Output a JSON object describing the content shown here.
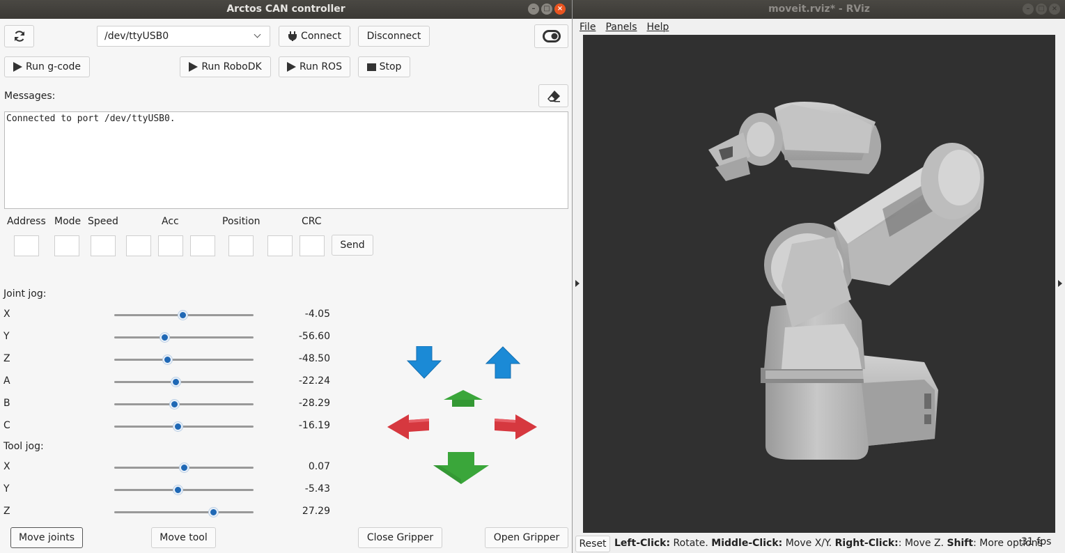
{
  "left_window": {
    "title": "Arctos CAN controller",
    "port_select": {
      "value": "/dev/ttyUSB0"
    },
    "buttons": {
      "connect": "Connect",
      "disconnect": "Disconnect",
      "run_gcode": "Run g-code",
      "run_robodk": "Run RoboDK",
      "run_ros": "Run ROS",
      "stop": "Stop",
      "send": "Send",
      "move_joints": "Move joints",
      "move_tool": "Move tool",
      "close_gripper": "Close Gripper",
      "open_gripper": "Open Gripper"
    },
    "messages_label": "Messages:",
    "messages_text": "Connected to port /dev/ttyUSB0.",
    "can_fields": {
      "headers": [
        "Address",
        "Mode",
        "Speed",
        "Acc",
        "Position",
        "CRC"
      ]
    },
    "joint_jog": {
      "label": "Joint jog:",
      "axes": [
        {
          "name": "X",
          "value": "-4.05",
          "level": 0.49
        },
        {
          "name": "Y",
          "value": "-56.60",
          "level": 0.36
        },
        {
          "name": "Z",
          "value": "-48.50",
          "level": 0.38
        },
        {
          "name": "A",
          "value": "-22.24",
          "level": 0.44
        },
        {
          "name": "B",
          "value": "-28.29",
          "level": 0.43
        },
        {
          "name": "C",
          "value": "-16.19",
          "level": 0.455
        }
      ]
    },
    "tool_jog": {
      "label": "Tool jog:",
      "axes": [
        {
          "name": "X",
          "value": "0.07",
          "level": 0.5
        },
        {
          "name": "Y",
          "value": "-5.43",
          "level": 0.455
        },
        {
          "name": "Z",
          "value": "27.29",
          "level": 0.71
        }
      ]
    }
  },
  "right_window": {
    "title": "moveit.rviz* - RViz",
    "menu": [
      "File",
      "Panels",
      "Help"
    ],
    "reset_button": "Reset",
    "status": {
      "left_click": "Left-Click:",
      "left_click_desc": " Rotate. ",
      "middle_click": "Middle-Click:",
      "middle_click_desc": " Move X/Y. ",
      "right_click": "Right-Click:",
      "right_click_desc": ": Move Z. ",
      "shift": "Shift",
      "shift_desc": ": More options"
    },
    "fps": "31 fps"
  },
  "colors": {
    "arrow_blue": "#1b8ad6",
    "arrow_green": "#3aa63a",
    "arrow_red": "#d6383f",
    "slider_thumb": "#1f68b5",
    "title_close": "#e95420"
  }
}
